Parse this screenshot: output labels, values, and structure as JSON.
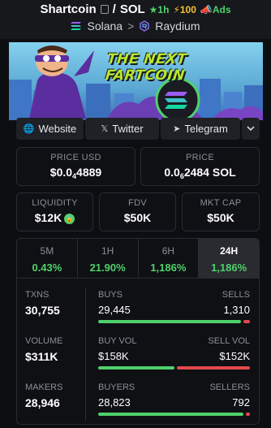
{
  "header": {
    "token": "Shartcoin",
    "slash": "/",
    "quote": "SOL",
    "age": "★1h",
    "boost": "⚡100",
    "ads": "Ads",
    "chain": "Solana",
    "chevron": ">",
    "dex": "Raydium"
  },
  "banner": {
    "text": "THE NEXT FARTCOIN"
  },
  "links": {
    "website": "Website",
    "twitter": "Twitter",
    "telegram": "Telegram"
  },
  "price_usd": {
    "label": "PRICE USD",
    "prefix": "$0.0",
    "zeros": "4",
    "digits": "4889"
  },
  "price_native": {
    "label": "PRICE",
    "prefix": "0.0",
    "zeros": "6",
    "digits": "2484 SOL"
  },
  "liquidity": {
    "label": "LIQUIDITY",
    "value": "$12K"
  },
  "fdv": {
    "label": "FDV",
    "value": "$50K"
  },
  "mkt_cap": {
    "label": "MKT CAP",
    "value": "$50K"
  },
  "tabs": [
    {
      "label": "5M",
      "value": "0.43%"
    },
    {
      "label": "1H",
      "value": "21.90%"
    },
    {
      "label": "6H",
      "value": "1,186%"
    },
    {
      "label": "24H",
      "value": "1,186%"
    }
  ],
  "stats": {
    "txns": {
      "label": "TXNS",
      "value": "30,755"
    },
    "volume": {
      "label": "VOLUME",
      "value": "$311K"
    },
    "makers": {
      "label": "MAKERS",
      "value": "28,946"
    },
    "buys": {
      "label": "BUYS",
      "value": "29,445"
    },
    "sells": {
      "label": "SELLS",
      "value": "1,310"
    },
    "buy_vol": {
      "label": "BUY VOL",
      "value": "$158K"
    },
    "sell_vol": {
      "label": "SELL VOL",
      "value": "$152K"
    },
    "buyers": {
      "label": "BUYERS",
      "value": "28,823"
    },
    "sellers": {
      "label": "SELLERS",
      "value": "792"
    }
  },
  "colors": {
    "green": "#4fd16b",
    "red": "#e5484d",
    "gold": "#f2c230",
    "background": "#0d0e12"
  },
  "bars": {
    "txns_buy_fraction": 0.957,
    "volume_buy_fraction": 0.51,
    "makers_buy_fraction": 0.973
  }
}
